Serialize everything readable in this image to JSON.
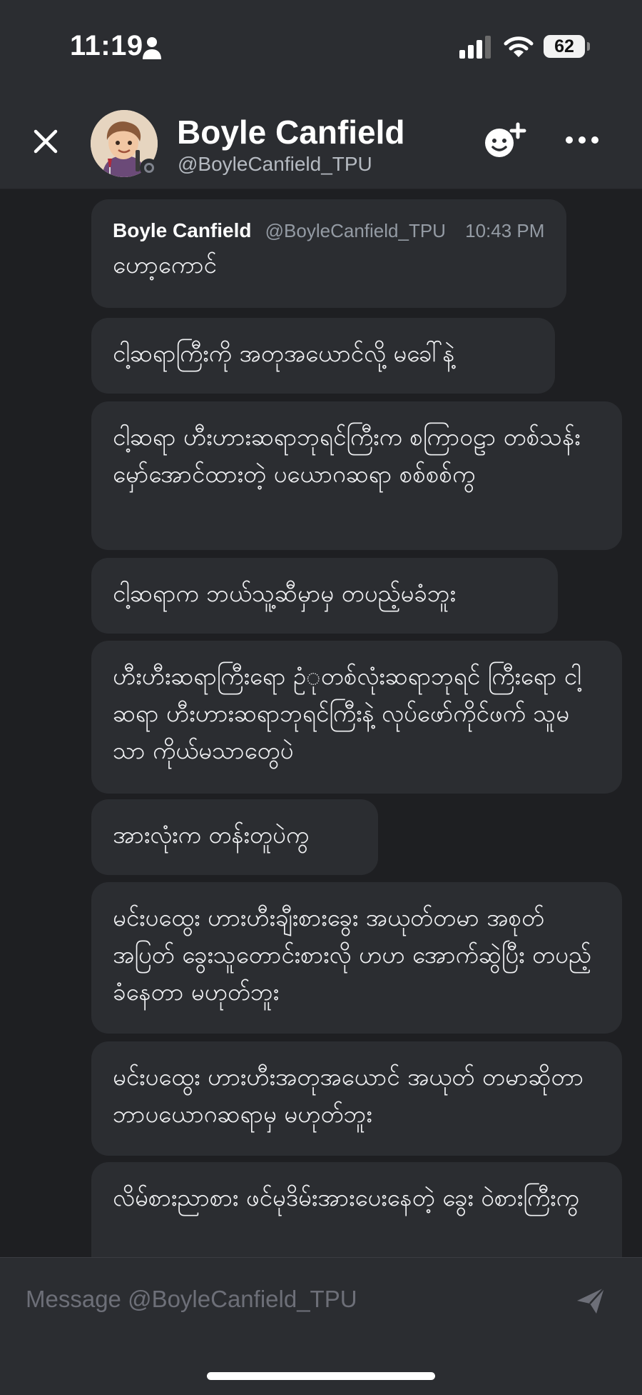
{
  "status_bar": {
    "time": "11:19",
    "battery": "62",
    "icons": [
      "person-icon",
      "cellular-signal-icon",
      "wifi-icon",
      "battery-icon"
    ]
  },
  "header": {
    "name": "Boyle Canfield",
    "handle": "@BoyleCanfield_TPU",
    "icons": [
      "close-icon",
      "avatar",
      "add-friend-icon",
      "more-icon"
    ]
  },
  "messages": [
    {
      "author": "Boyle Canfield",
      "handle": "@BoyleCanfield_TPU",
      "time": "10:43 PM",
      "text": "ဟော့ကောင်"
    },
    {
      "text": "ငါ့ဆရာကြီးကို အတုအယောင်လို့ မခေါ်နဲ့"
    },
    {
      "text": "ငါ့ဆရာ ဟီးဟားဆရာဘုရင်ကြီးက စကြာဝဠာ တစ်သန်း မှော်အောင်ထားတဲ့ ပယောဂဆရာ စစ်စစ်ကွ"
    },
    {
      "text": "ငါ့ဆရာက ဘယ်သူ့ဆီမှာမှ တပည့်မခံဘူး"
    },
    {
      "text": "ဟီးဟီးဆရာကြီးရော ဥံုတစ်လုံးဆရာဘုရင် ကြီးရော ငါ့ဆရာ ဟီးဟားဆရာဘုရင်ကြီးနဲ့ လုပ်ဖော်ကိုင်ဖက် သူမသာ ကိုယ်မသာတွေပဲ"
    },
    {
      "text": "အားလုံးက တန်းတူပဲကွ"
    },
    {
      "text": "မင်းပထွေး ဟားဟီးချီးစားခွေး အယုတ်တမာ အစုတ်အပြတ် ခွေးသူတောင်းစားလို ဟဟ အောက်ဆွဲပြီး တပည့်ခံနေတာ မဟုတ်ဘူး"
    },
    {
      "text": "မင်းပထွေး ဟားဟီးအတုအယောင် အယုတ် တမာဆိုတာ ဘာပယောဂဆရာမှ မဟုတ်ဘူး"
    },
    {
      "text": "လိမ်စားညာစား ဖင်မုဒိမ်းအားပေးနေတဲ့ ခွေး ဝဲစားကြီးကွ"
    }
  ],
  "composer": {
    "placeholder": "Message @BoyleCanfield_TPU",
    "icons": [
      "send-icon"
    ]
  },
  "colors": {
    "background": "#1e1f22",
    "surface": "#2b2d31",
    "text": "#f2f3f5",
    "muted": "#949ba4"
  }
}
